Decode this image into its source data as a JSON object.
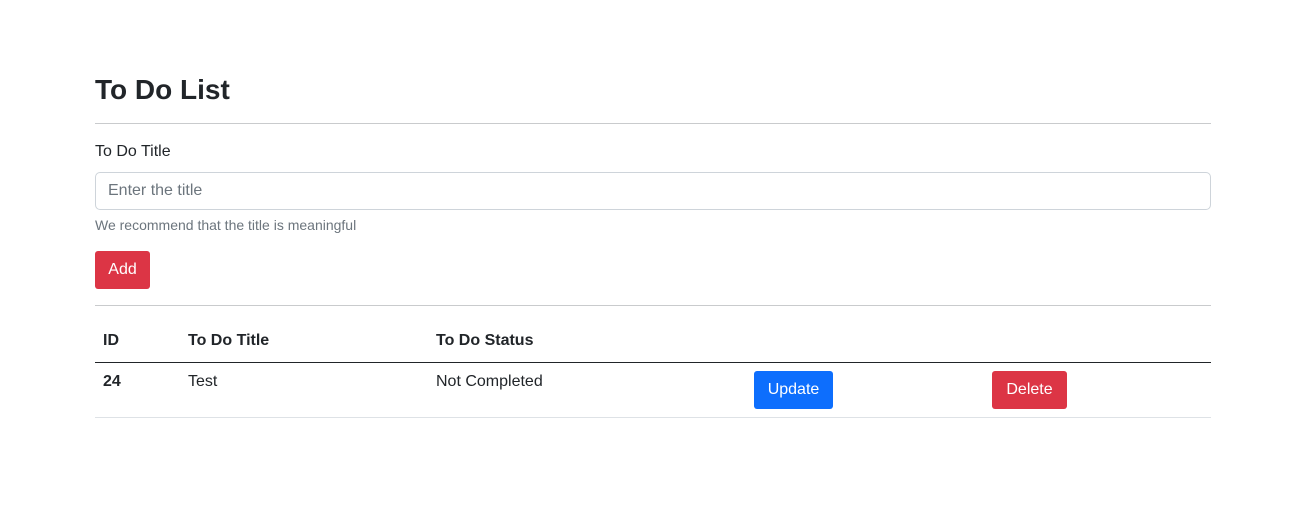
{
  "page": {
    "title": "To Do List"
  },
  "form": {
    "label": "To Do Title",
    "input_placeholder": "Enter the title",
    "input_value": "",
    "help_text": "We recommend that the title is meaningful",
    "add_label": "Add"
  },
  "table": {
    "headers": [
      "ID",
      "To Do Title",
      "To Do Status",
      "",
      ""
    ],
    "rows": [
      {
        "id": "24",
        "title": "Test",
        "status": "Not Completed",
        "update_label": "Update",
        "delete_label": "Delete"
      }
    ]
  },
  "colors": {
    "danger": "#dc3545",
    "primary": "#0d6efd",
    "muted_text": "#6c757d"
  }
}
